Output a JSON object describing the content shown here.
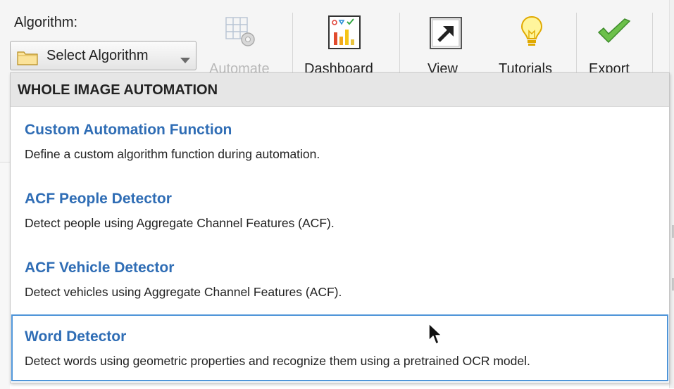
{
  "toolstrip": {
    "algorithm_label": "Algorithm:",
    "select_algorithm": "Select Algorithm",
    "buttons": [
      {
        "label": "Automate",
        "icon": "automate-icon",
        "enabled": false
      },
      {
        "label": "Dashboard",
        "icon": "dashboard-icon",
        "enabled": true
      },
      {
        "label": "View",
        "icon": "view-icon",
        "enabled": true
      },
      {
        "label": "Tutorials",
        "icon": "lightbulb-icon",
        "enabled": true
      },
      {
        "label": "Export",
        "icon": "checkmark-icon",
        "enabled": true
      }
    ]
  },
  "menu": {
    "header": "WHOLE IMAGE AUTOMATION",
    "items": [
      {
        "title": "Custom Automation Function",
        "description": "Define a custom algorithm function during automation."
      },
      {
        "title": "ACF People Detector",
        "description": "Detect people using Aggregate Channel Features (ACF)."
      },
      {
        "title": "ACF Vehicle Detector",
        "description": "Detect vehicles using Aggregate Channel Features (ACF)."
      },
      {
        "title": "Word Detector",
        "description": "Detect words using geometric properties and recognize them using a pretrained OCR model."
      }
    ],
    "hovered_index": 3
  },
  "colors": {
    "item_title": "#2f6db5",
    "hover_border": "#4f95d8",
    "header_bg": "#e6e6e6",
    "toolstrip_bg": "#f5f5f5"
  }
}
